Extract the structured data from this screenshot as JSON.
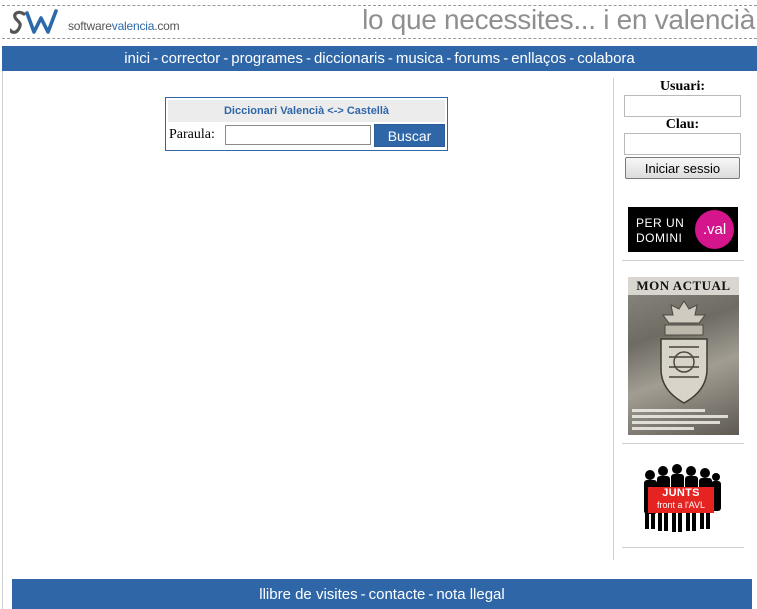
{
  "header": {
    "logo_icon": "sw-logo-icon",
    "site_name_prefix": "software",
    "site_name_accent": "valencia",
    "site_name_suffix": ".com",
    "slogan": "lo que necessites... i en valencià"
  },
  "nav": {
    "separator": "-",
    "items": [
      {
        "label": "inici"
      },
      {
        "label": "corrector"
      },
      {
        "label": "programes"
      },
      {
        "label": "diccionaris"
      },
      {
        "label": "musica"
      },
      {
        "label": "forums"
      },
      {
        "label": "enllaços"
      },
      {
        "label": "colabora"
      }
    ]
  },
  "dictionary": {
    "title": "Diccionari Valencià <-> Castellà",
    "word_label": "Paraula:",
    "word_value": "",
    "search_button": "Buscar"
  },
  "login": {
    "user_label": "Usuari:",
    "user_value": "",
    "password_label": "Clau:",
    "password_value": "",
    "submit_button": "Iniciar sessio"
  },
  "sidebar_banners": {
    "val_line1": "PER UN",
    "val_line2": "DOMINI",
    "val_circle": ".val",
    "magazine_title": "MON ACTUAL",
    "junts_line1": "JUNTS",
    "junts_line2": "front a l'AVL"
  },
  "footer": {
    "separator": "-",
    "links": [
      {
        "label": "llibre de visites"
      },
      {
        "label": "contacte"
      },
      {
        "label": "nota llegal"
      }
    ]
  },
  "colors": {
    "brand_blue": "#2f66a8",
    "val_pink": "#d4158c",
    "junts_red": "#e52320"
  }
}
